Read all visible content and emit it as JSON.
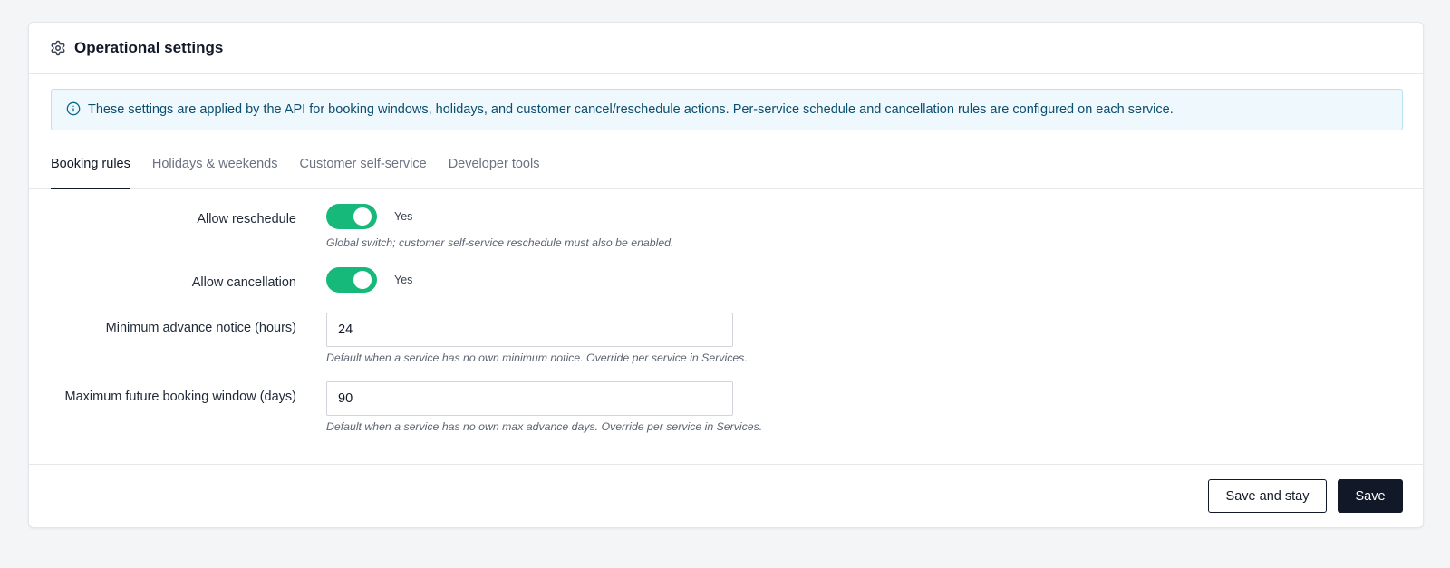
{
  "header": {
    "title": "Operational settings",
    "icon": "gear-icon"
  },
  "banner": {
    "icon": "info-icon",
    "text": "These settings are applied by the API for booking windows, holidays, and customer cancel/reschedule actions. Per-service schedule and cancellation rules are configured on each service."
  },
  "tabs": [
    {
      "label": "Booking rules",
      "active": true
    },
    {
      "label": "Holidays & weekends",
      "active": false
    },
    {
      "label": "Customer self-service",
      "active": false
    },
    {
      "label": "Developer tools",
      "active": false
    }
  ],
  "form": {
    "allow_reschedule": {
      "label": "Allow reschedule",
      "state": "Yes",
      "help": "Global switch; customer self-service reschedule must also be enabled."
    },
    "allow_cancellation": {
      "label": "Allow cancellation",
      "state": "Yes"
    },
    "min_notice": {
      "label": "Minimum advance notice (hours)",
      "value": "24",
      "help": "Default when a service has no own minimum notice. Override per service in Services."
    },
    "max_window": {
      "label": "Maximum future booking window (days)",
      "value": "90",
      "help": "Default when a service has no own max advance days. Override per service in Services."
    }
  },
  "footer": {
    "save_and_stay": "Save and stay",
    "save": "Save"
  },
  "colors": {
    "toggle_on": "#16b979",
    "primary": "#111827",
    "banner_bg": "#eff8fd",
    "banner_text": "#0b4e6e"
  }
}
